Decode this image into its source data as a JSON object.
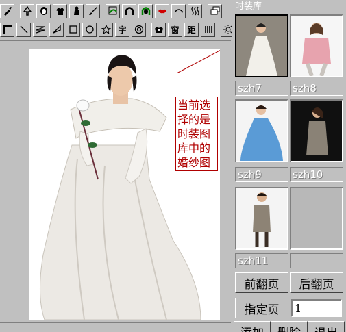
{
  "toolbar1": {
    "icons": [
      "eyedropper-icon",
      "tree-icon",
      "face-icon",
      "shirt-icon",
      "person-icon",
      "brush-icon",
      "curve-select-icon",
      "arch-icon",
      "head-icon",
      "lips-icon",
      "arc-icon",
      "wave-icon",
      "layers-icon"
    ]
  },
  "toolbar2": {
    "icons": [
      "corner-icon",
      "line-icon",
      "zigzag-icon",
      "lasso-icon",
      "rectangle-icon",
      "circle-icon",
      "star-icon"
    ],
    "text_tool": "字",
    "tools_after": [
      "target-icon",
      "stamp-icon"
    ],
    "window_label": "窗",
    "distance_label": "距",
    "bars_icon": "bars-icon",
    "sun_icon": "sun-icon"
  },
  "canvas": {
    "note_lines": [
      "当前选",
      "择的是",
      "时装图",
      "库中的",
      "婚纱图"
    ]
  },
  "panel": {
    "title": "时装库",
    "thumbnails": [
      {
        "label": "szh7",
        "selected": true
      },
      {
        "label": "szh8",
        "selected": false
      },
      {
        "label": "szh9",
        "selected": false
      },
      {
        "label": "szh10",
        "selected": false
      },
      {
        "label": "szh11",
        "selected": false
      },
      {
        "label": "",
        "selected": false
      }
    ],
    "prev_page": "前翻页",
    "next_page": "后翻页",
    "goto_page": "指定页",
    "page_value": "1",
    "add": "添加",
    "delete": "删除",
    "exit": "退出"
  }
}
